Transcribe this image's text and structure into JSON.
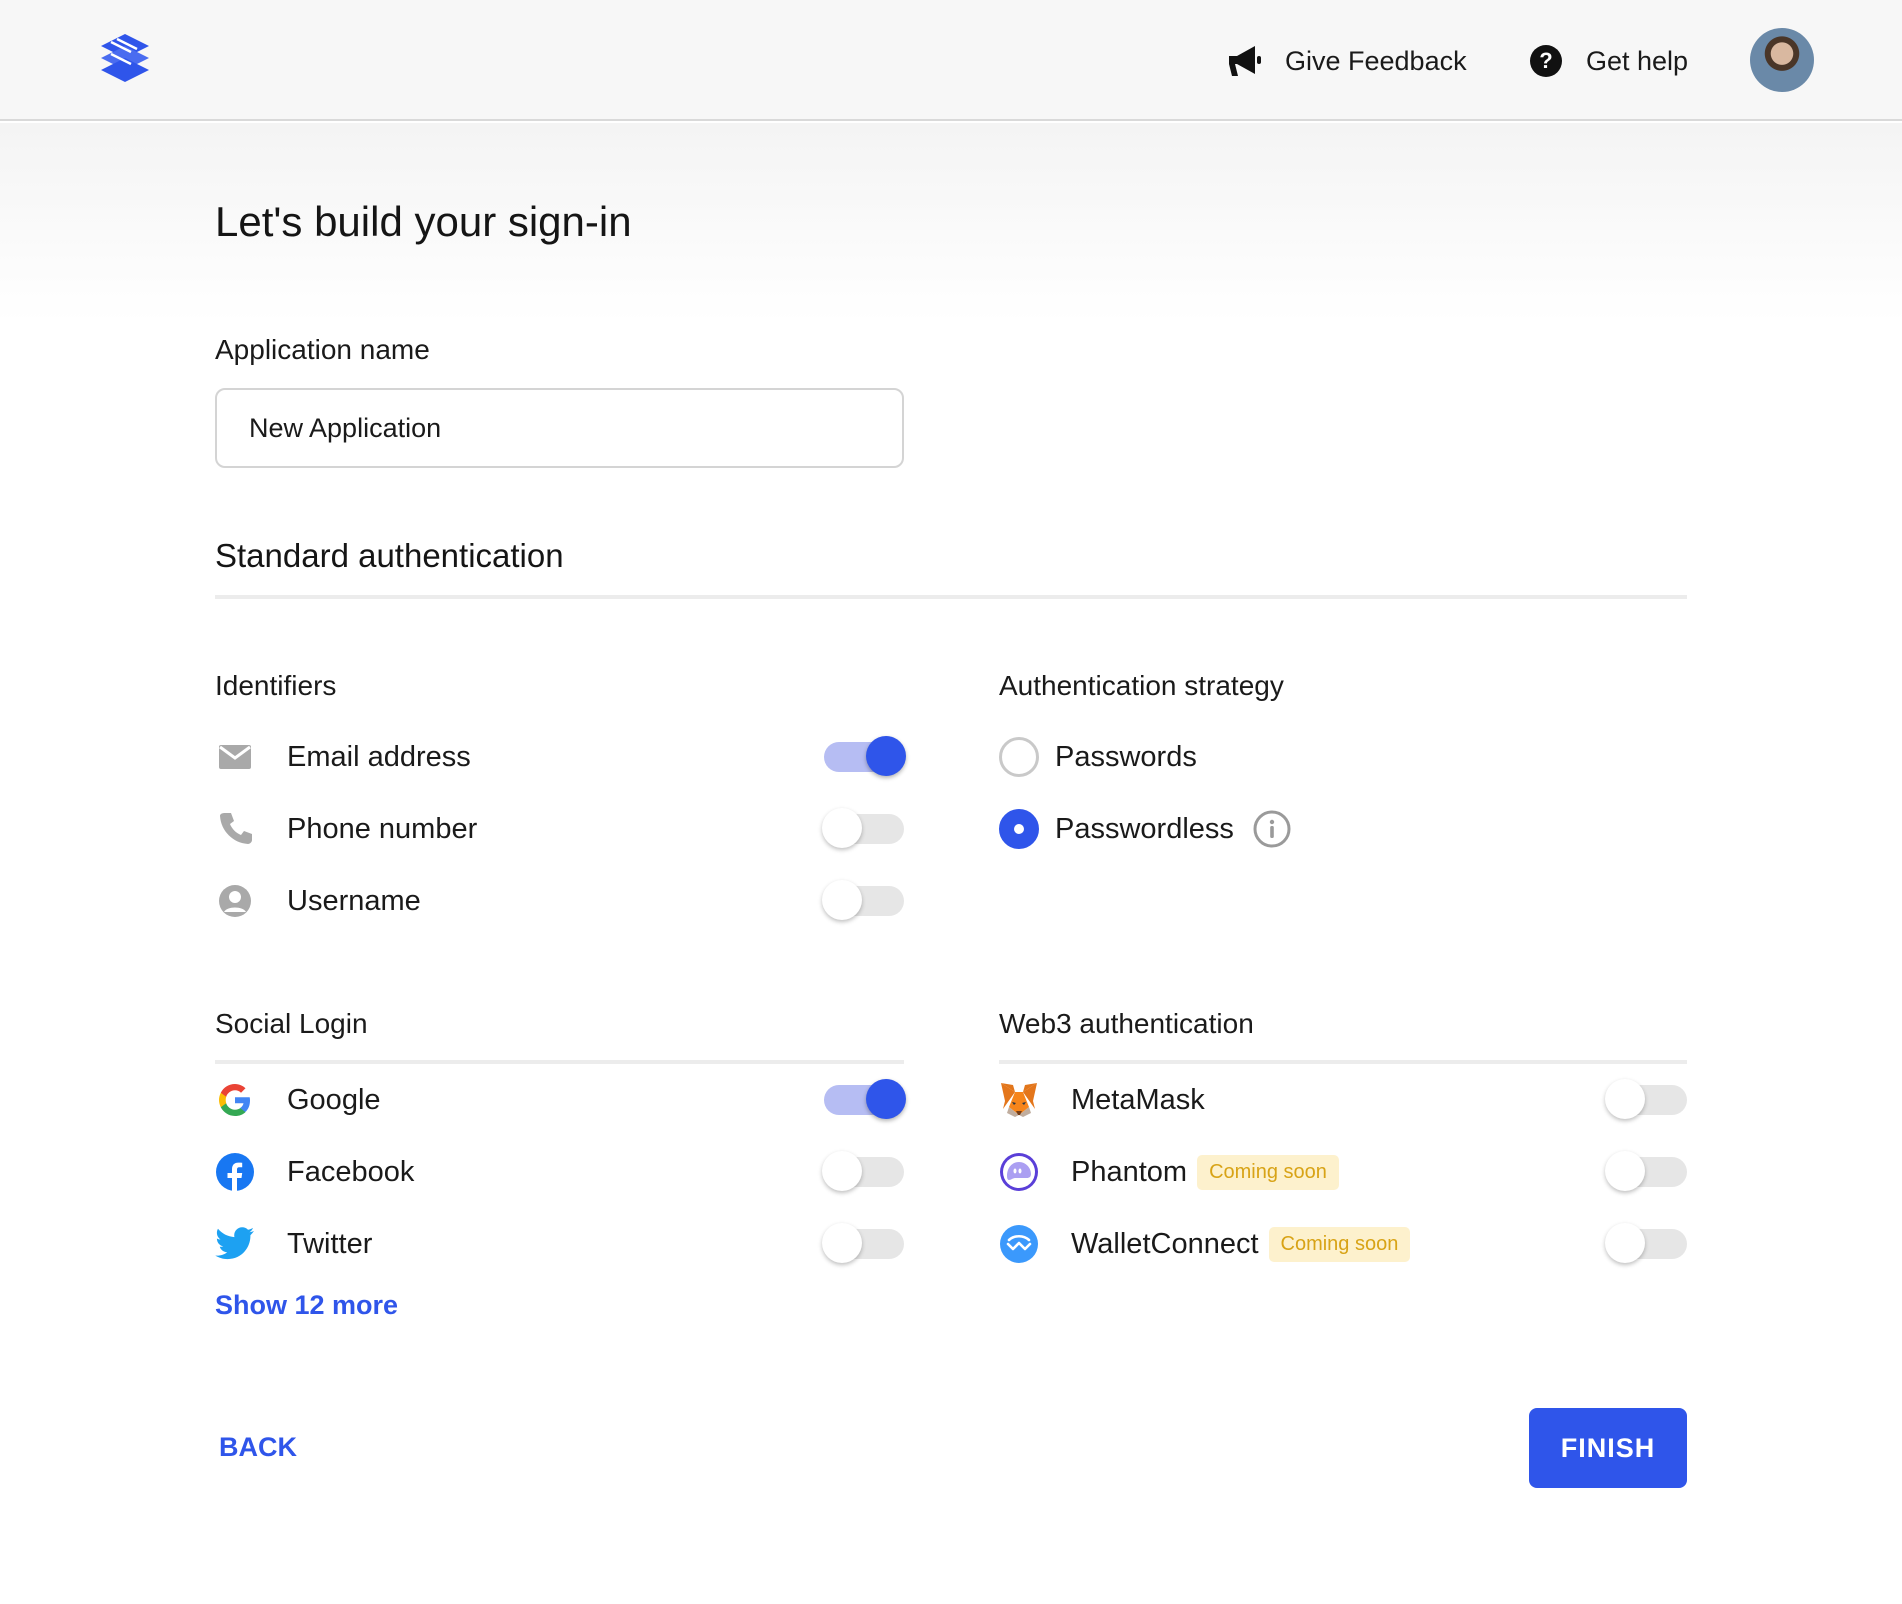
{
  "header": {
    "give_feedback": "Give Feedback",
    "get_help": "Get help"
  },
  "page": {
    "title": "Let's build your sign-in",
    "app_name_label": "Application name",
    "app_name_value": "New Application",
    "standard_auth_title": "Standard authentication"
  },
  "identifiers": {
    "title": "Identifiers",
    "items": [
      {
        "label": "Email address",
        "icon": "email-icon",
        "enabled": true
      },
      {
        "label": "Phone number",
        "icon": "phone-icon",
        "enabled": false
      },
      {
        "label": "Username",
        "icon": "user-icon",
        "enabled": false
      }
    ]
  },
  "auth_strategy": {
    "title": "Authentication strategy",
    "options": [
      {
        "label": "Passwords",
        "selected": false
      },
      {
        "label": "Passwordless",
        "selected": true
      }
    ]
  },
  "social_login": {
    "title": "Social Login",
    "items": [
      {
        "label": "Google",
        "icon": "google-icon",
        "enabled": true
      },
      {
        "label": "Facebook",
        "icon": "facebook-icon",
        "enabled": false
      },
      {
        "label": "Twitter",
        "icon": "twitter-icon",
        "enabled": false
      }
    ],
    "show_more": "Show 12 more"
  },
  "web3": {
    "title": "Web3 authentication",
    "items": [
      {
        "label": "MetaMask",
        "icon": "metamask-icon",
        "enabled": false,
        "badge": ""
      },
      {
        "label": "Phantom",
        "icon": "phantom-icon",
        "enabled": false,
        "badge": "Coming soon"
      },
      {
        "label": "WalletConnect",
        "icon": "walletconnect-icon",
        "enabled": false,
        "badge": "Coming soon"
      }
    ]
  },
  "footer": {
    "back": "BACK",
    "finish": "FINISH"
  },
  "colors": {
    "accent": "#2f55ea",
    "toggle_on_track": "#b6bdf3",
    "badge_bg": "#fdf1cd",
    "badge_text": "#d8a316"
  }
}
